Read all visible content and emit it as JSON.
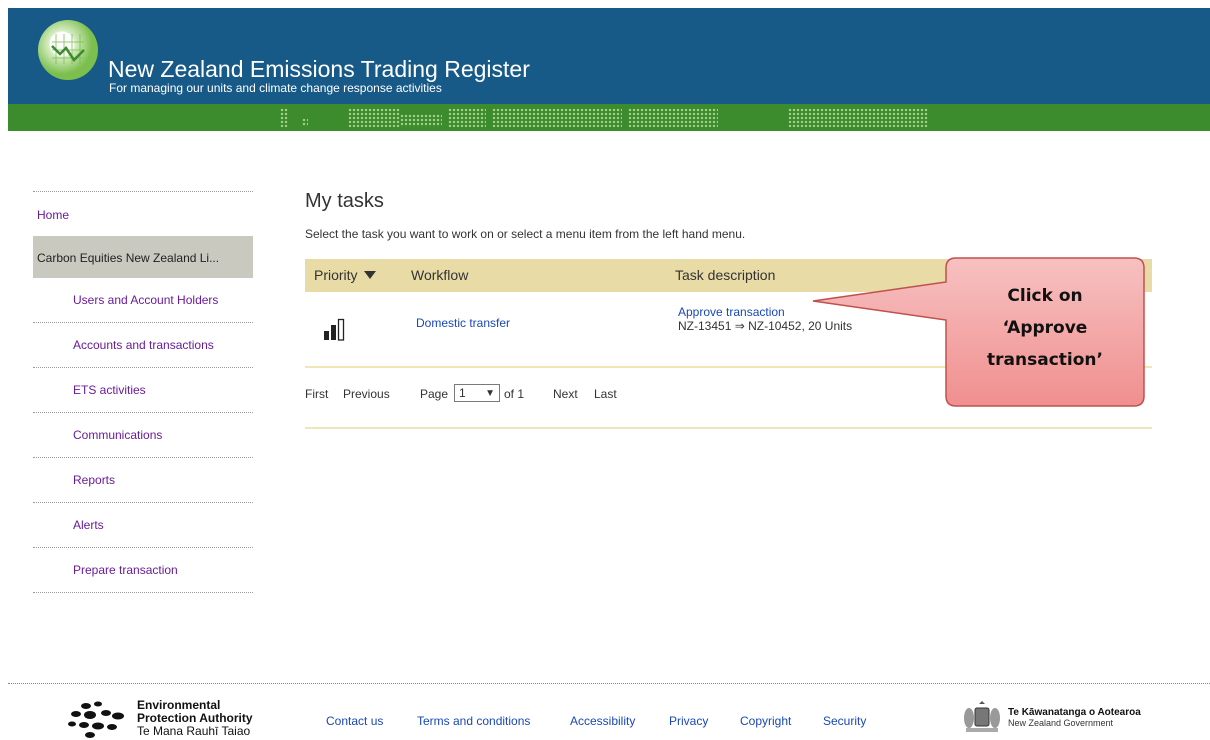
{
  "header": {
    "title": "New Zealand Emissions Trading Register",
    "subtitle": "For managing our units and climate change response activities",
    "logo_icon": "climate-chart-logo-icon"
  },
  "sidebar": {
    "home": "Home",
    "organisation": "Carbon Equities New Zealand Li...",
    "items": [
      {
        "label": "Users and Account Holders"
      },
      {
        "label": "Accounts and transactions"
      },
      {
        "label": "ETS activities"
      },
      {
        "label": "Communications"
      },
      {
        "label": "Reports"
      },
      {
        "label": "Alerts"
      },
      {
        "label": "Prepare transaction"
      }
    ]
  },
  "main": {
    "title": "My tasks",
    "instruction": "Select the task you want to work on or select a menu item from the left hand menu.",
    "columns": {
      "priority": "Priority",
      "workflow": "Workflow",
      "task_description": "Task description"
    },
    "rows": [
      {
        "priority_icon": "priority-bars-icon",
        "workflow": "Domestic transfer",
        "action": "Approve transaction",
        "details": "NZ-13451 ⇒ NZ-10452, 20 Units"
      }
    ],
    "pager": {
      "first": "First",
      "previous": "Previous",
      "page_label": "Page",
      "page_value": "1",
      "of_label": "of 1",
      "next": "Next",
      "last": "Last"
    }
  },
  "callout": {
    "line1": "Click on",
    "line2": "‘Approve",
    "line3": "transaction’"
  },
  "footer": {
    "epa_line1": "Environmental",
    "epa_line2": "Protection Authority",
    "epa_line3": "Te Mana Rauhī Taiao",
    "links": [
      "Contact us",
      "Terms and conditions",
      "Accessibility",
      "Privacy",
      "Copyright",
      "Security"
    ],
    "gov_line1": "Te Kāwanatanga o Aotearoa",
    "gov_line2": "New Zealand Government"
  },
  "colors": {
    "header_blue": "#175a88",
    "band_green": "#3c8b2d",
    "table_header": "#e9dba6",
    "link_blue": "#1a48b8",
    "nav_purple": "#6a1b9a",
    "callout_fill": "#f4a5a5",
    "callout_border": "#c0504d"
  }
}
